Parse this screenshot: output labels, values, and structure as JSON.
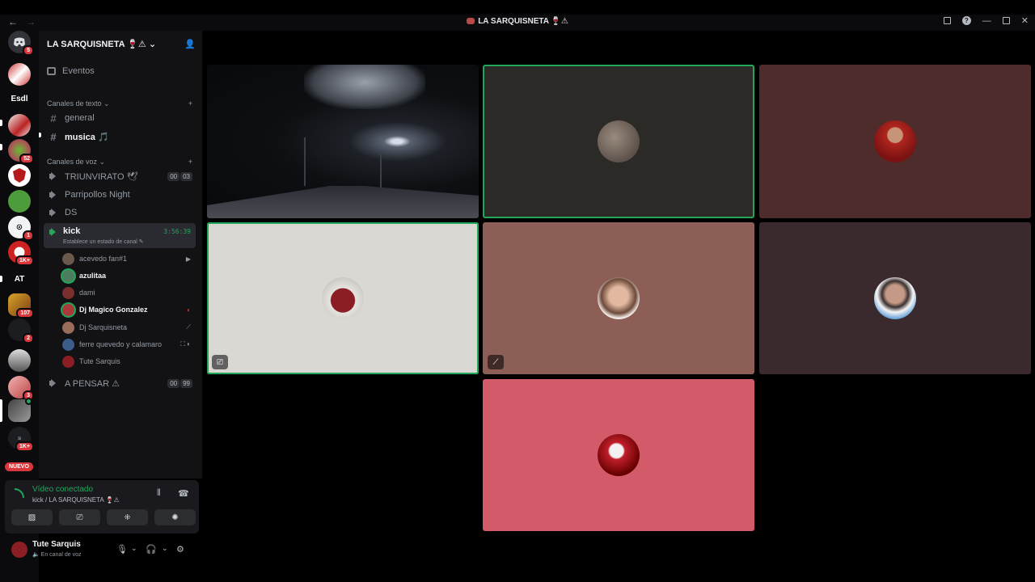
{
  "window": {
    "title": "LA SARQUISNETA",
    "title_suffix": "⚠"
  },
  "rail": {
    "badges": [
      "5",
      "52",
      "1",
      "1K+",
      "107",
      "2",
      "3",
      "1K+"
    ],
    "text_servers": [
      "Esdl",
      "AT"
    ],
    "nuevo": "NUEVO"
  },
  "guild": {
    "name": "LA SARQUISNETA 🍷⚠",
    "events": "Eventos",
    "text_category": "Canales de texto",
    "voice_category": "Canales de voz"
  },
  "text_channels": [
    {
      "name": "general"
    },
    {
      "name": "musica 🎵"
    }
  ],
  "voice_channels": {
    "triunvirato": {
      "name": "TRIUNVIRATO 🕊",
      "a": "00",
      "b": "03"
    },
    "parripollos": {
      "name": "Parripollos Night"
    },
    "ds": {
      "name": "DS"
    },
    "kick": {
      "name": "kick",
      "status": "Establece un estado de canal ✎",
      "time": "3:56:39"
    },
    "apensar": {
      "name": "A PENSAR ⚠",
      "a": "00",
      "b": "99"
    }
  },
  "voice_users": [
    {
      "name": "acevedo fan#1",
      "color": "#6b5a4c",
      "extra": "▶"
    },
    {
      "name": "azulitaa",
      "color": "#4d7d5f",
      "extra": ""
    },
    {
      "name": "dami",
      "color": "#7a2e2e",
      "extra": ""
    },
    {
      "name": "Dj Magico Gonzalez",
      "color": "#a83a3a",
      "extra": "◐"
    },
    {
      "name": "Dj Sarquisneta",
      "color": "#9a6c5a",
      "extra": "⟋"
    },
    {
      "name": "ferre quevedo y calamaro",
      "color": "#3a5d8a",
      "extra": "⛶ ◐"
    },
    {
      "name": "Tute Sarquis",
      "color": "#8b1e24",
      "extra": ""
    }
  ],
  "voice_panel": {
    "connected": "Vídeo conectado",
    "location": "kick / LA SARQUISNETA 🍷⚠"
  },
  "user_panel": {
    "name": "Tute Sarquis",
    "state": "En canal de voz"
  },
  "tiles": {
    "t2_bg": "#2b2a26",
    "t3_bg": "#4d2c2b",
    "t4_bg": "#d9d8d3",
    "t5_bg": "#8d5e56",
    "t6_bg": "#3a2a2e",
    "t7_bg": "#d35b69"
  },
  "colors": {
    "speaking": "#23a55a",
    "badge": "#da373c"
  }
}
